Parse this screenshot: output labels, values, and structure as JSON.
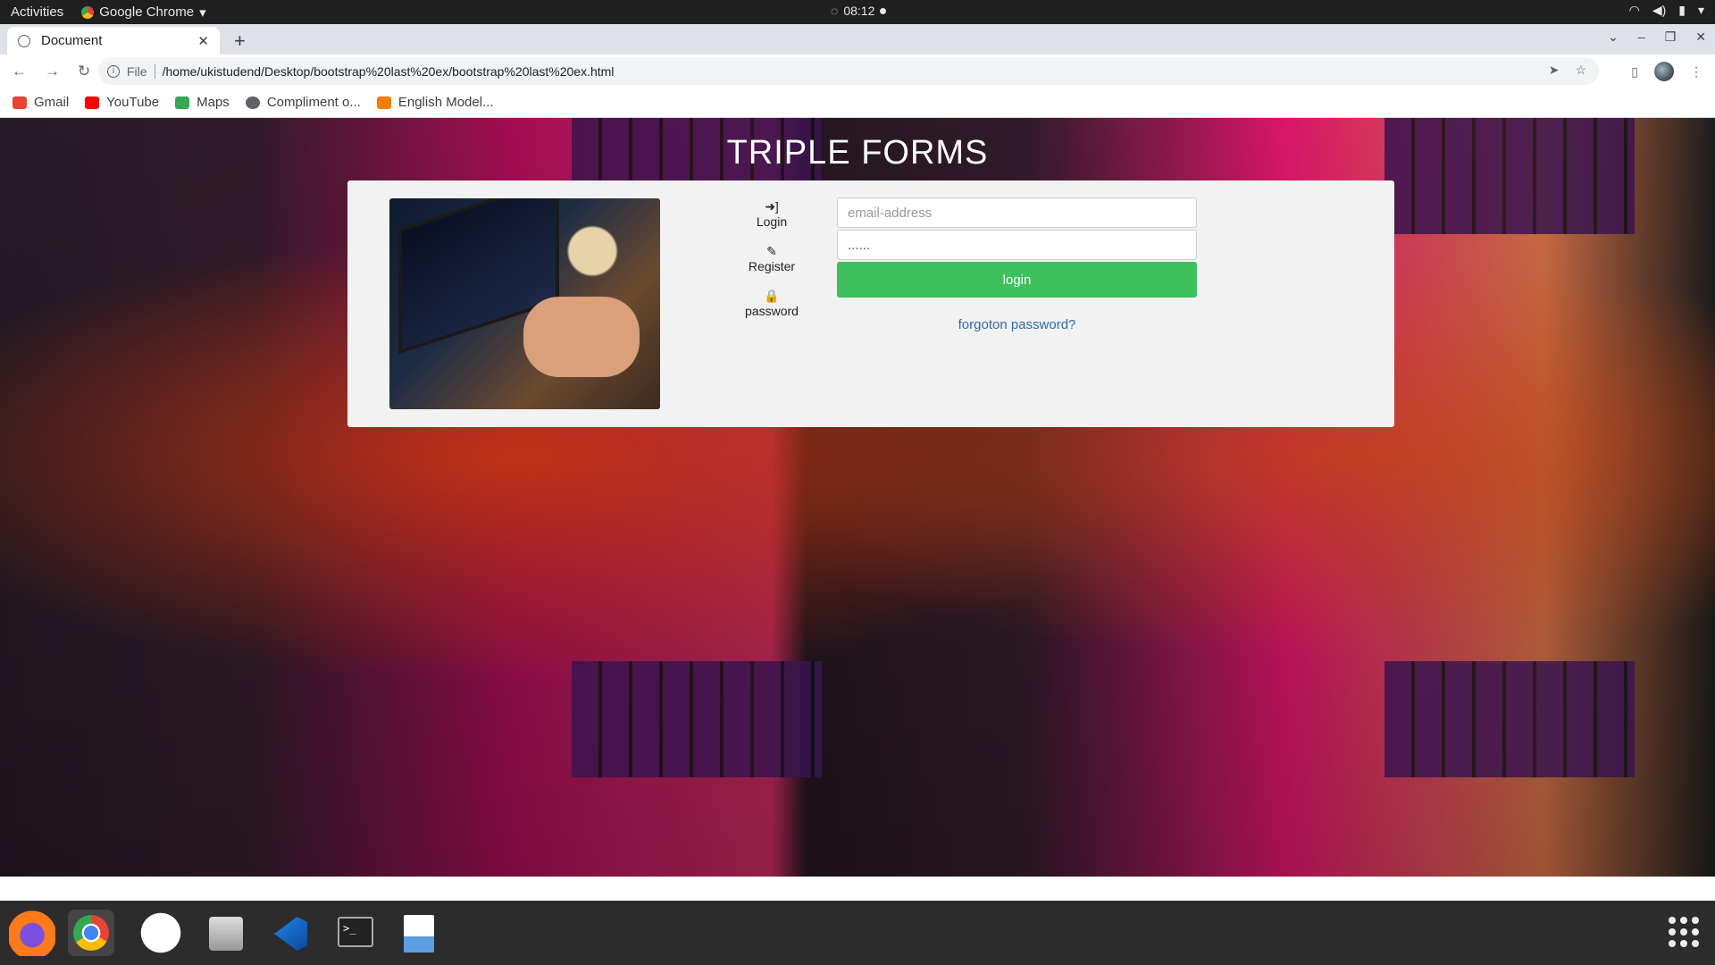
{
  "topbar": {
    "activities": "Activities",
    "app_name": "Google Chrome",
    "time": "08:12"
  },
  "browser": {
    "tab_title": "Document",
    "address_scheme": "File",
    "address_url": "/home/ukistudend/Desktop/bootstrap%20last%20ex/bootstrap%20last%20ex.html",
    "bookmarks": [
      {
        "label": "Gmail",
        "icon": "gmail-icon",
        "color": "#ea4335"
      },
      {
        "label": "YouTube",
        "icon": "youtube-icon",
        "color": "#ff0000"
      },
      {
        "label": "Maps",
        "icon": "maps-icon",
        "color": "#34a853"
      },
      {
        "label": "Compliment o...",
        "icon": "globe-icon",
        "color": "#5f6368"
      },
      {
        "label": "English Model...",
        "icon": "blogger-icon",
        "color": "#f57d00"
      }
    ]
  },
  "page": {
    "title": "TRIPLE FORMS",
    "menu": [
      {
        "label": "Login",
        "icon": "sign-in-icon"
      },
      {
        "label": "Register",
        "icon": "pencil-icon"
      },
      {
        "label": "password",
        "icon": "lock-icon"
      }
    ],
    "email_placeholder": "email-address",
    "password_value": "......",
    "login_button": "login",
    "forgot_link": "forgoton password?",
    "accent_color": "#3cc15c",
    "link_color": "#2c6bb2"
  },
  "dock": {
    "apps": [
      "firefox-icon",
      "chrome-icon",
      "slack-icon",
      "files-icon",
      "vscode-icon",
      "terminal-icon",
      "image-viewer-icon"
    ]
  }
}
